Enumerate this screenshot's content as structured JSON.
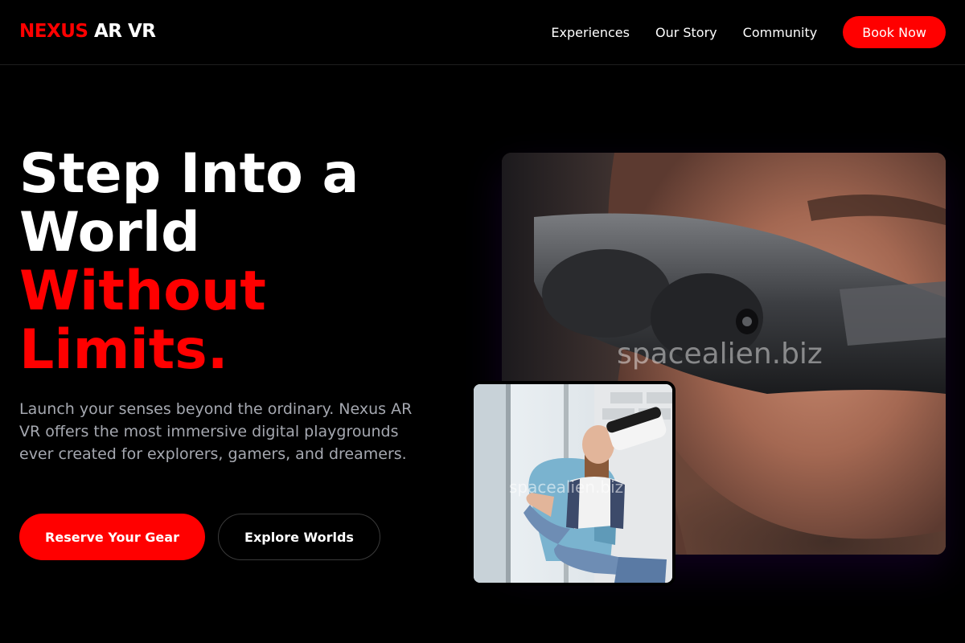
{
  "nav": {
    "logo_accent": "NEXUS",
    "logo_rest": "AR VR",
    "links": [
      {
        "label": "Experiences"
      },
      {
        "label": "Our Story"
      },
      {
        "label": "Community"
      }
    ],
    "cta_label": "Book Now"
  },
  "hero": {
    "title_line1": "Step Into a",
    "title_line2": "World",
    "title_line3": "Without",
    "title_line4": "Limits.",
    "description": "Launch your senses beyond the ordinary. Nexus AR VR offers the most immersive digital playgrounds ever created for explorers, gamers, and dreamers.",
    "primary_button": "Reserve Your Gear",
    "secondary_button": "Explore Worlds"
  },
  "images": {
    "main_watermark": "spacealien.biz",
    "inset_watermark": "spacealien.biz"
  },
  "colors": {
    "accent": "#ff0000",
    "background": "#000000",
    "muted_text": "#a5a8b0"
  }
}
